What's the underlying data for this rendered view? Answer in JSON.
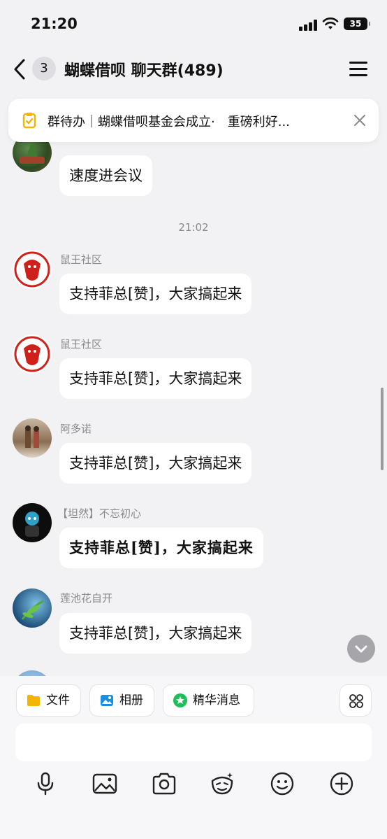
{
  "status_bar": {
    "time": "21:20",
    "battery": "35"
  },
  "nav": {
    "unread_count": "3",
    "title": "蝴蝶借呗 聊天群(489)"
  },
  "todo_banner": {
    "text": "群待办｜蝴蝶借呗基金会成立·　重磅利好..."
  },
  "messages": [
    {
      "sender": "",
      "text": "速度进会议"
    },
    {
      "sender": "鼠王社区",
      "text": "支持菲总[赞]，大家搞起来"
    },
    {
      "sender": "鼠王社区",
      "text": "支持菲总[赞]，大家搞起来"
    },
    {
      "sender": "阿多诺",
      "text": "支持菲总[赞]，大家搞起来"
    },
    {
      "sender": "【坦然】不忘初心",
      "text": "支持菲总[赞]，大家搞起来"
    },
    {
      "sender": "莲池花自开",
      "text": "支持菲总[赞]，大家搞起来"
    }
  ],
  "time_separator": "21:02",
  "quick_actions": [
    {
      "label": "文件",
      "icon": "folder-icon"
    },
    {
      "label": "相册",
      "icon": "photo-icon"
    },
    {
      "label": "精华消息",
      "icon": "star-icon"
    }
  ],
  "input": {
    "value": "",
    "placeholder": ""
  },
  "toolbar_icons": [
    "microphone-icon",
    "image-icon",
    "camera-icon",
    "sticker-icon",
    "emoji-icon",
    "plus-icon"
  ],
  "colors": {
    "background": "#f2f2f4",
    "bubble": "#ffffff",
    "accent_yellow": "#f4b400",
    "accent_blue": "#1e8fe0",
    "accent_green": "#1ebf5a"
  }
}
